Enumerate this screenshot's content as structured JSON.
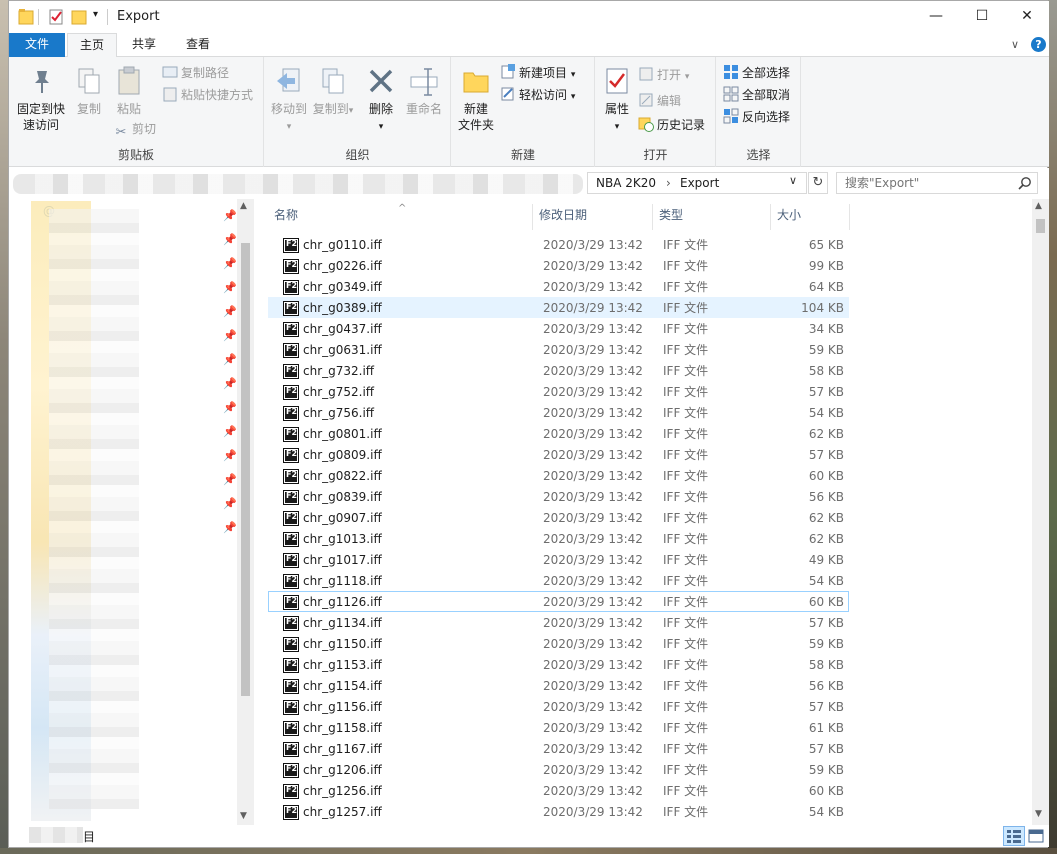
{
  "window": {
    "title": "Export",
    "minimize": "—",
    "maximize": "☐",
    "close": "✕"
  },
  "ribbon_tabs": {
    "file": "文件",
    "home": "主页",
    "share": "共享",
    "view": "查看",
    "collapse": "∨",
    "help": "?"
  },
  "ribbon": {
    "clipboard": {
      "label": "剪贴板",
      "pin_line1": "固定到快",
      "pin_line2": "速访问",
      "copy": "复制",
      "paste": "粘贴",
      "copy_path": "复制路径",
      "paste_shortcut": "粘贴快捷方式",
      "cut": "剪切"
    },
    "organize": {
      "label": "组织",
      "move_to": "移动到",
      "copy_to": "复制到",
      "delete": "删除",
      "rename": "重命名"
    },
    "new": {
      "label": "新建",
      "new_folder_line1": "新建",
      "new_folder_line2": "文件夹",
      "new_item": "新建项目",
      "easy_access": "轻松访问"
    },
    "open": {
      "label": "打开",
      "properties": "属性",
      "open": "打开",
      "edit": "编辑",
      "history": "历史记录"
    },
    "select": {
      "label": "选择",
      "select_all": "全部选择",
      "select_none": "全部取消",
      "invert": "反向选择"
    }
  },
  "address": {
    "crumbs": [
      "NBA 2K20",
      "Export"
    ],
    "separator": "›",
    "dropdown": "∨",
    "refresh": "↻",
    "search_placeholder": "搜索\"Export\""
  },
  "nav": {
    "top_label": "@",
    "status_fragment": "目"
  },
  "columns": {
    "name": "名称",
    "date": "修改日期",
    "type": "类型",
    "size": "大小",
    "sort_caret": "^"
  },
  "files": [
    {
      "name": "chr_g0110.iff",
      "date": "2020/3/29 13:42",
      "type": "IFF 文件",
      "size": "65 KB"
    },
    {
      "name": "chr_g0226.iff",
      "date": "2020/3/29 13:42",
      "type": "IFF 文件",
      "size": "99 KB"
    },
    {
      "name": "chr_g0349.iff",
      "date": "2020/3/29 13:42",
      "type": "IFF 文件",
      "size": "64 KB"
    },
    {
      "name": "chr_g0389.iff",
      "date": "2020/3/29 13:42",
      "type": "IFF 文件",
      "size": "104 KB"
    },
    {
      "name": "chr_g0437.iff",
      "date": "2020/3/29 13:42",
      "type": "IFF 文件",
      "size": "34 KB"
    },
    {
      "name": "chr_g0631.iff",
      "date": "2020/3/29 13:42",
      "type": "IFF 文件",
      "size": "59 KB"
    },
    {
      "name": "chr_g732.iff",
      "date": "2020/3/29 13:42",
      "type": "IFF 文件",
      "size": "58 KB"
    },
    {
      "name": "chr_g752.iff",
      "date": "2020/3/29 13:42",
      "type": "IFF 文件",
      "size": "57 KB"
    },
    {
      "name": "chr_g756.iff",
      "date": "2020/3/29 13:42",
      "type": "IFF 文件",
      "size": "54 KB"
    },
    {
      "name": "chr_g0801.iff",
      "date": "2020/3/29 13:42",
      "type": "IFF 文件",
      "size": "62 KB"
    },
    {
      "name": "chr_g0809.iff",
      "date": "2020/3/29 13:42",
      "type": "IFF 文件",
      "size": "57 KB"
    },
    {
      "name": "chr_g0822.iff",
      "date": "2020/3/29 13:42",
      "type": "IFF 文件",
      "size": "60 KB"
    },
    {
      "name": "chr_g0839.iff",
      "date": "2020/3/29 13:42",
      "type": "IFF 文件",
      "size": "56 KB"
    },
    {
      "name": "chr_g0907.iff",
      "date": "2020/3/29 13:42",
      "type": "IFF 文件",
      "size": "62 KB"
    },
    {
      "name": "chr_g1013.iff",
      "date": "2020/3/29 13:42",
      "type": "IFF 文件",
      "size": "62 KB"
    },
    {
      "name": "chr_g1017.iff",
      "date": "2020/3/29 13:42",
      "type": "IFF 文件",
      "size": "49 KB"
    },
    {
      "name": "chr_g1118.iff",
      "date": "2020/3/29 13:42",
      "type": "IFF 文件",
      "size": "54 KB"
    },
    {
      "name": "chr_g1126.iff",
      "date": "2020/3/29 13:42",
      "type": "IFF 文件",
      "size": "60 KB"
    },
    {
      "name": "chr_g1134.iff",
      "date": "2020/3/29 13:42",
      "type": "IFF 文件",
      "size": "57 KB"
    },
    {
      "name": "chr_g1150.iff",
      "date": "2020/3/29 13:42",
      "type": "IFF 文件",
      "size": "59 KB"
    },
    {
      "name": "chr_g1153.iff",
      "date": "2020/3/29 13:42",
      "type": "IFF 文件",
      "size": "58 KB"
    },
    {
      "name": "chr_g1154.iff",
      "date": "2020/3/29 13:42",
      "type": "IFF 文件",
      "size": "56 KB"
    },
    {
      "name": "chr_g1156.iff",
      "date": "2020/3/29 13:42",
      "type": "IFF 文件",
      "size": "57 KB"
    },
    {
      "name": "chr_g1158.iff",
      "date": "2020/3/29 13:42",
      "type": "IFF 文件",
      "size": "61 KB"
    },
    {
      "name": "chr_g1167.iff",
      "date": "2020/3/29 13:42",
      "type": "IFF 文件",
      "size": "57 KB"
    },
    {
      "name": "chr_g1206.iff",
      "date": "2020/3/29 13:42",
      "type": "IFF 文件",
      "size": "59 KB"
    },
    {
      "name": "chr_g1256.iff",
      "date": "2020/3/29 13:42",
      "type": "IFF 文件",
      "size": "60 KB"
    },
    {
      "name": "chr_g1257.iff",
      "date": "2020/3/29 13:42",
      "type": "IFF 文件",
      "size": "54 KB"
    }
  ],
  "hovered_index": 3,
  "focused_index": 17,
  "colors": {
    "accent": "#1979ca",
    "hover": "#e5f3ff",
    "focus_border": "#99d1ff",
    "header_text": "#4c607a"
  },
  "icons": {
    "file": "iff-file-icon",
    "pin": "pin-icon",
    "search": "search-icon"
  }
}
